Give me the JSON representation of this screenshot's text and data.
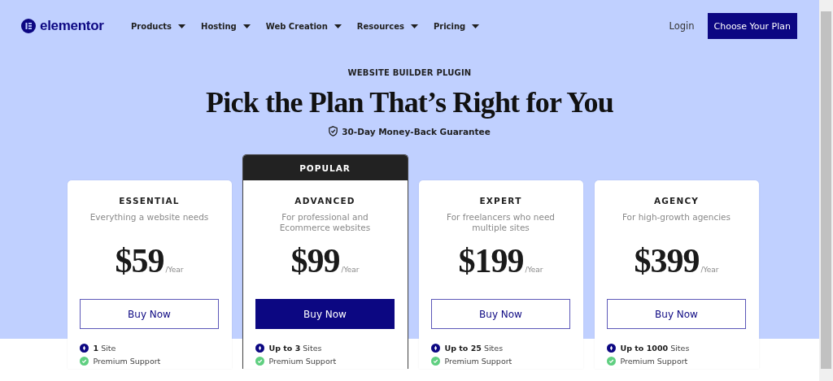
{
  "header": {
    "logo": "elementor",
    "nav": [
      {
        "label": "Products"
      },
      {
        "label": "Hosting"
      },
      {
        "label": "Web Creation"
      },
      {
        "label": "Resources"
      },
      {
        "label": "Pricing"
      }
    ],
    "login": "Login",
    "cta": "Choose Your Plan"
  },
  "hero": {
    "eyebrow": "WEBSITE BUILDER PLUGIN",
    "title": "Pick the Plan That’s Right for You",
    "guarantee": "30-Day Money-Back Guarantee"
  },
  "plans": [
    {
      "name": "ESSENTIAL",
      "description": "Everything a website needs",
      "price": "$59",
      "period": "/Year",
      "popular": false,
      "button": "Buy Now",
      "features": [
        {
          "kind": "sites",
          "text": "**1** Site"
        },
        {
          "kind": "check",
          "text": "Premium Support"
        }
      ]
    },
    {
      "name": "ADVANCED",
      "badge": "POPULAR",
      "description": "For professional and Ecommerce websites",
      "price": "$99",
      "period": "/Year",
      "popular": true,
      "button": "Buy Now",
      "features": [
        {
          "kind": "sites",
          "text": "**Up to 3** Sites"
        },
        {
          "kind": "check",
          "text": "Premium Support"
        }
      ]
    },
    {
      "name": "EXPERT",
      "description": "For freelancers who need multiple sites",
      "price": "$199",
      "period": "/Year",
      "popular": false,
      "button": "Buy Now",
      "features": [
        {
          "kind": "sites",
          "text": "**Up to 25** Sites"
        },
        {
          "kind": "check",
          "text": "Premium Support"
        }
      ]
    },
    {
      "name": "AGENCY",
      "description": "For high-growth agencies",
      "price": "$399",
      "period": "/Year",
      "popular": false,
      "button": "Buy Now",
      "features": [
        {
          "kind": "sites",
          "text": "**Up to 1000** Sites"
        },
        {
          "kind": "check",
          "text": "Premium Support"
        }
      ]
    }
  ]
}
